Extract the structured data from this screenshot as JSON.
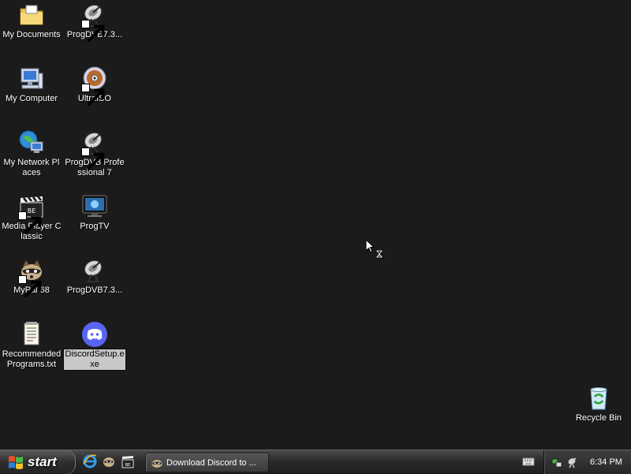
{
  "desktop": {
    "icons": [
      {
        "label": "My Documents",
        "icon": "folder-icon"
      },
      {
        "label": "ProgDVB7.3...",
        "icon": "satellite-dish-icon"
      },
      {
        "label": "My Computer",
        "icon": "computer-icon"
      },
      {
        "label": "UltraISO",
        "icon": "disc-icon"
      },
      {
        "label": "My Network Places",
        "icon": "network-globe-icon"
      },
      {
        "label": "ProgDVB Professional 7",
        "icon": "satellite-dish-icon"
      },
      {
        "label": "Media Player Classic",
        "icon": "clapperboard-icon"
      },
      {
        "label": "ProgTV",
        "icon": "tv-monitor-icon"
      },
      {
        "label": "MyPal 68",
        "icon": "raccoon-icon"
      },
      {
        "label": "ProgDVB7.3...",
        "icon": "satellite-dish-icon"
      },
      {
        "label": "Recommended Programs.txt",
        "icon": "text-document-icon"
      },
      {
        "label": "DiscordSetup.exe",
        "icon": "discord-icon"
      },
      {
        "label": "Recycle Bin",
        "icon": "recycle-bin-icon"
      }
    ]
  },
  "taskbar": {
    "start_label": "start",
    "quick_launch": [
      "internet-explorer-icon",
      "raccoon-icon",
      "clapperboard-icon"
    ],
    "active_window": "Download Discord to ...",
    "clock": "6:34 PM"
  },
  "colors": {
    "desktop_background": "#1b1b1b",
    "selection": "#c8c8c8",
    "discord_blurple": "#5865f2"
  }
}
